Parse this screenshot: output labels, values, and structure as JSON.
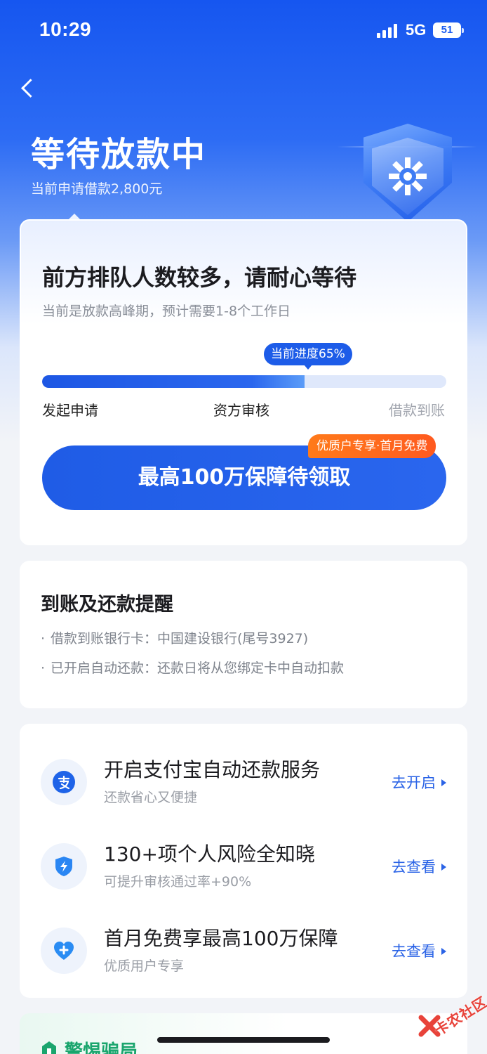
{
  "status_bar": {
    "time": "10:29",
    "network": "5G",
    "battery": "51"
  },
  "header": {
    "title": "等待放款中",
    "subtitle": "当前申请借款2,800元"
  },
  "queue_card": {
    "title": "前方排队人数较多，请耐心等待",
    "description": "当前是放款高峰期，预计需要1-8个工作日",
    "progress_label": "当前进度65%",
    "progress_value": 0.65,
    "steps": [
      "发起申请",
      "资方审核",
      "借款到账"
    ],
    "cta_label": "最高100万保障待领取",
    "cta_badge": "优质户专享·首月免费"
  },
  "reminder_card": {
    "title": "到账及还款提醒",
    "lines": [
      "借款到账银行卡：中国建设银行(尾号3927)",
      "已开启自动还款：还款日将从您绑定卡中自动扣款"
    ]
  },
  "services": [
    {
      "icon": "alipay-icon",
      "title": "开启支付宝自动还款服务",
      "subtitle": "还款省心又便捷",
      "action": "去开启"
    },
    {
      "icon": "shield-lightning-icon",
      "title": "130+项个人风险全知晓",
      "subtitle": "可提升审核通过率+90%",
      "action": "去查看"
    },
    {
      "icon": "heart-plus-icon",
      "title": "首月免费享最高100万保障",
      "subtitle": "优质用户专享",
      "action": "去查看"
    }
  ],
  "warning_card": {
    "title": "警惕骗局"
  },
  "watermark": "卡农社区",
  "colors": {
    "brand_blue": "#1d5ce8",
    "accent_orange": "#ff6a1f",
    "warn_green": "#1aa56d"
  }
}
